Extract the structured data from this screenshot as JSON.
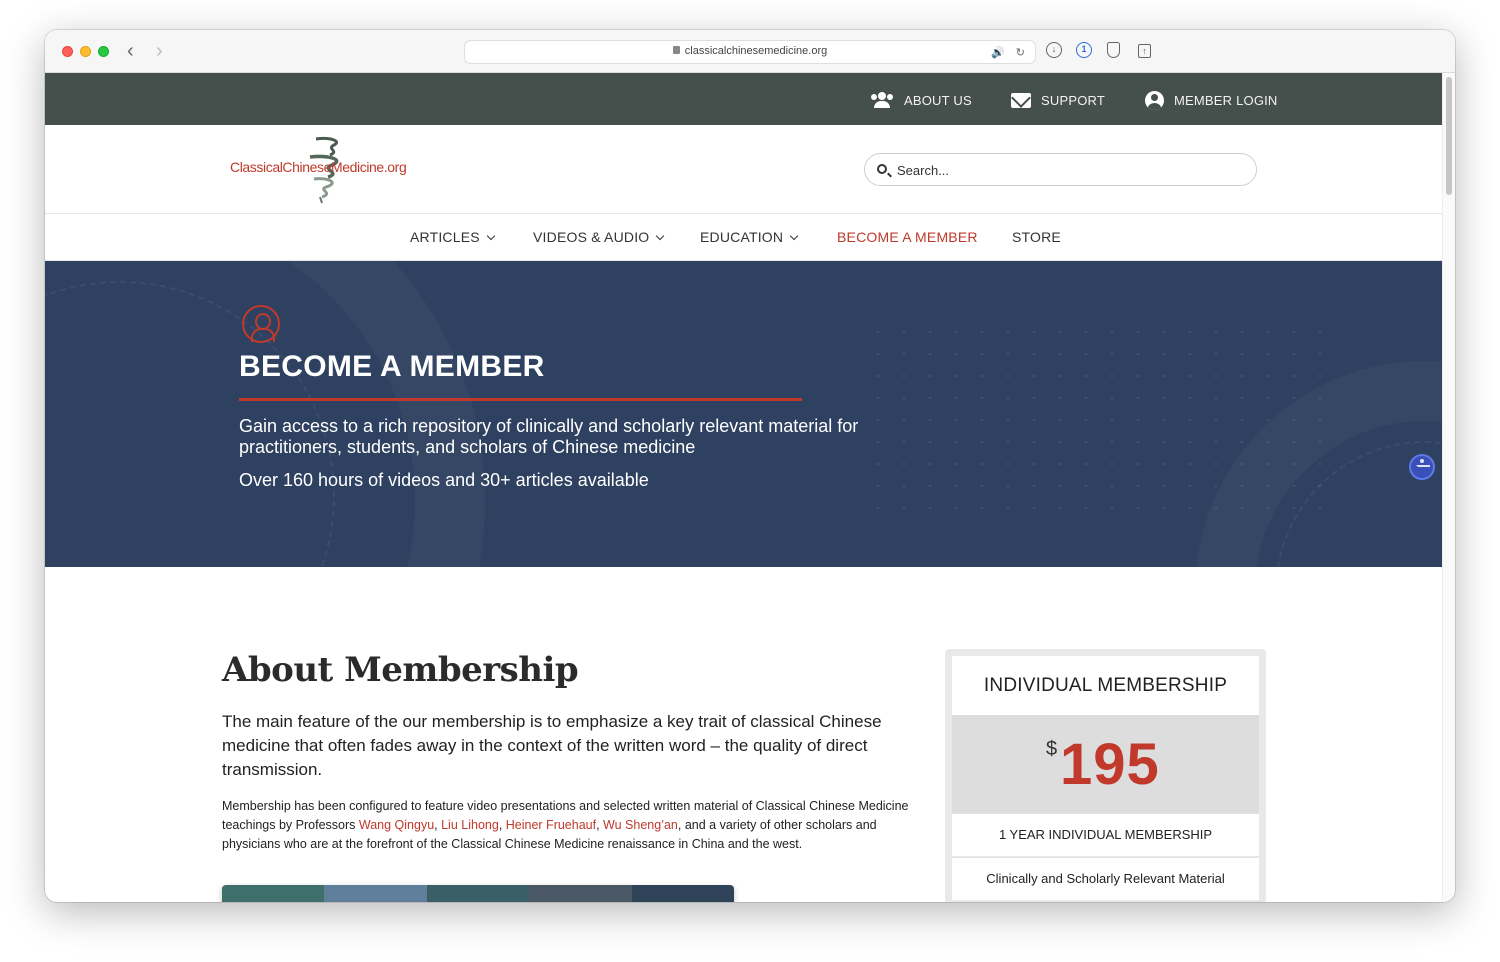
{
  "browser": {
    "url": "classicalchinesemedicine.org"
  },
  "topbar": {
    "about_label": "ABOUT US",
    "support_label": "SUPPORT",
    "login_label": "MEMBER LOGIN"
  },
  "header": {
    "logo_text": "ClassicalChineseMedicine.org",
    "search_placeholder": "Search..."
  },
  "nav": {
    "items": [
      {
        "label": "ARTICLES",
        "has_dropdown": true
      },
      {
        "label": "VIDEOS & AUDIO",
        "has_dropdown": true
      },
      {
        "label": "EDUCATION",
        "has_dropdown": true
      },
      {
        "label": "BECOME A MEMBER",
        "active": true
      },
      {
        "label": "STORE"
      }
    ]
  },
  "hero": {
    "title": "BECOME A MEMBER",
    "description": "Gain access to a rich repository of clinically and scholarly relevant material for practitioners, students, and scholars of Chinese medicine",
    "stat": "Over 160 hours of videos and 30+ articles available"
  },
  "about": {
    "title": "About Membership",
    "lead": "The main feature of the our membership is to emphasize a key trait of classical Chinese medicine that often fades away in the context of the written word – the quality of direct transmission.",
    "body_prefix": "Membership has been configured to feature video presentations and selected written material of Classical Chinese Medicine teachings by Professors ",
    "professors": [
      "Wang Qingyu",
      "Liu Lihong",
      "Heiner Fruehauf",
      "Wu Sheng’an"
    ],
    "sep": ", ",
    "body_suffix": ", and a variety of other scholars and physicians who are at the forefront of the Classical Chinese Medicine renaissance in China and the west."
  },
  "pricing": {
    "title": "INDIVIDUAL MEMBERSHIP",
    "currency": "$",
    "amount": "195",
    "features": [
      "1 YEAR INDIVIDUAL MEMBERSHIP",
      "Clinically and Scholarly Relevant Material"
    ]
  },
  "colors": {
    "accent": "#c0392b",
    "topbar": "#454f4c",
    "hero": "#2e4160"
  }
}
